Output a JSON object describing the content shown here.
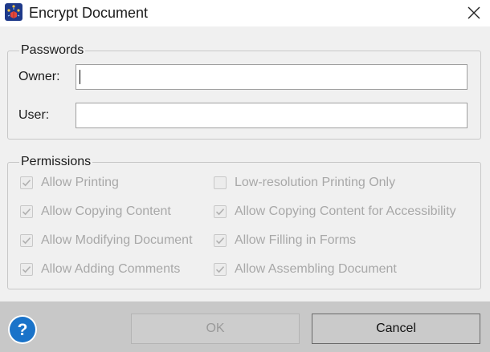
{
  "window": {
    "title": "Encrypt Document",
    "icon": "app-icon",
    "close_icon": "close-icon"
  },
  "passwords": {
    "legend": "Passwords",
    "owner_label": "Owner:",
    "owner_value": "",
    "user_label": "User:",
    "user_value": ""
  },
  "permissions": {
    "legend": "Permissions",
    "items": [
      {
        "label": "Allow Printing",
        "checked": true,
        "enabled": false
      },
      {
        "label": "Low-resolution Printing Only",
        "checked": false,
        "enabled": false
      },
      {
        "label": "Allow Copying Content",
        "checked": true,
        "enabled": false
      },
      {
        "label": "Allow Copying Content for Accessibility",
        "checked": true,
        "enabled": false
      },
      {
        "label": "Allow Modifying Document",
        "checked": true,
        "enabled": false
      },
      {
        "label": "Allow Filling in Forms",
        "checked": true,
        "enabled": false
      },
      {
        "label": "Allow Adding Comments",
        "checked": true,
        "enabled": false
      },
      {
        "label": "Allow Assembling Document",
        "checked": true,
        "enabled": false
      }
    ]
  },
  "footer": {
    "help_icon": "help-icon",
    "ok_label": "OK",
    "ok_enabled": false,
    "cancel_label": "Cancel"
  },
  "colors": {
    "help_blue": "#1a73c9",
    "disabled_text": "#a8a8a8",
    "footer_bg": "#c8c8c8"
  }
}
